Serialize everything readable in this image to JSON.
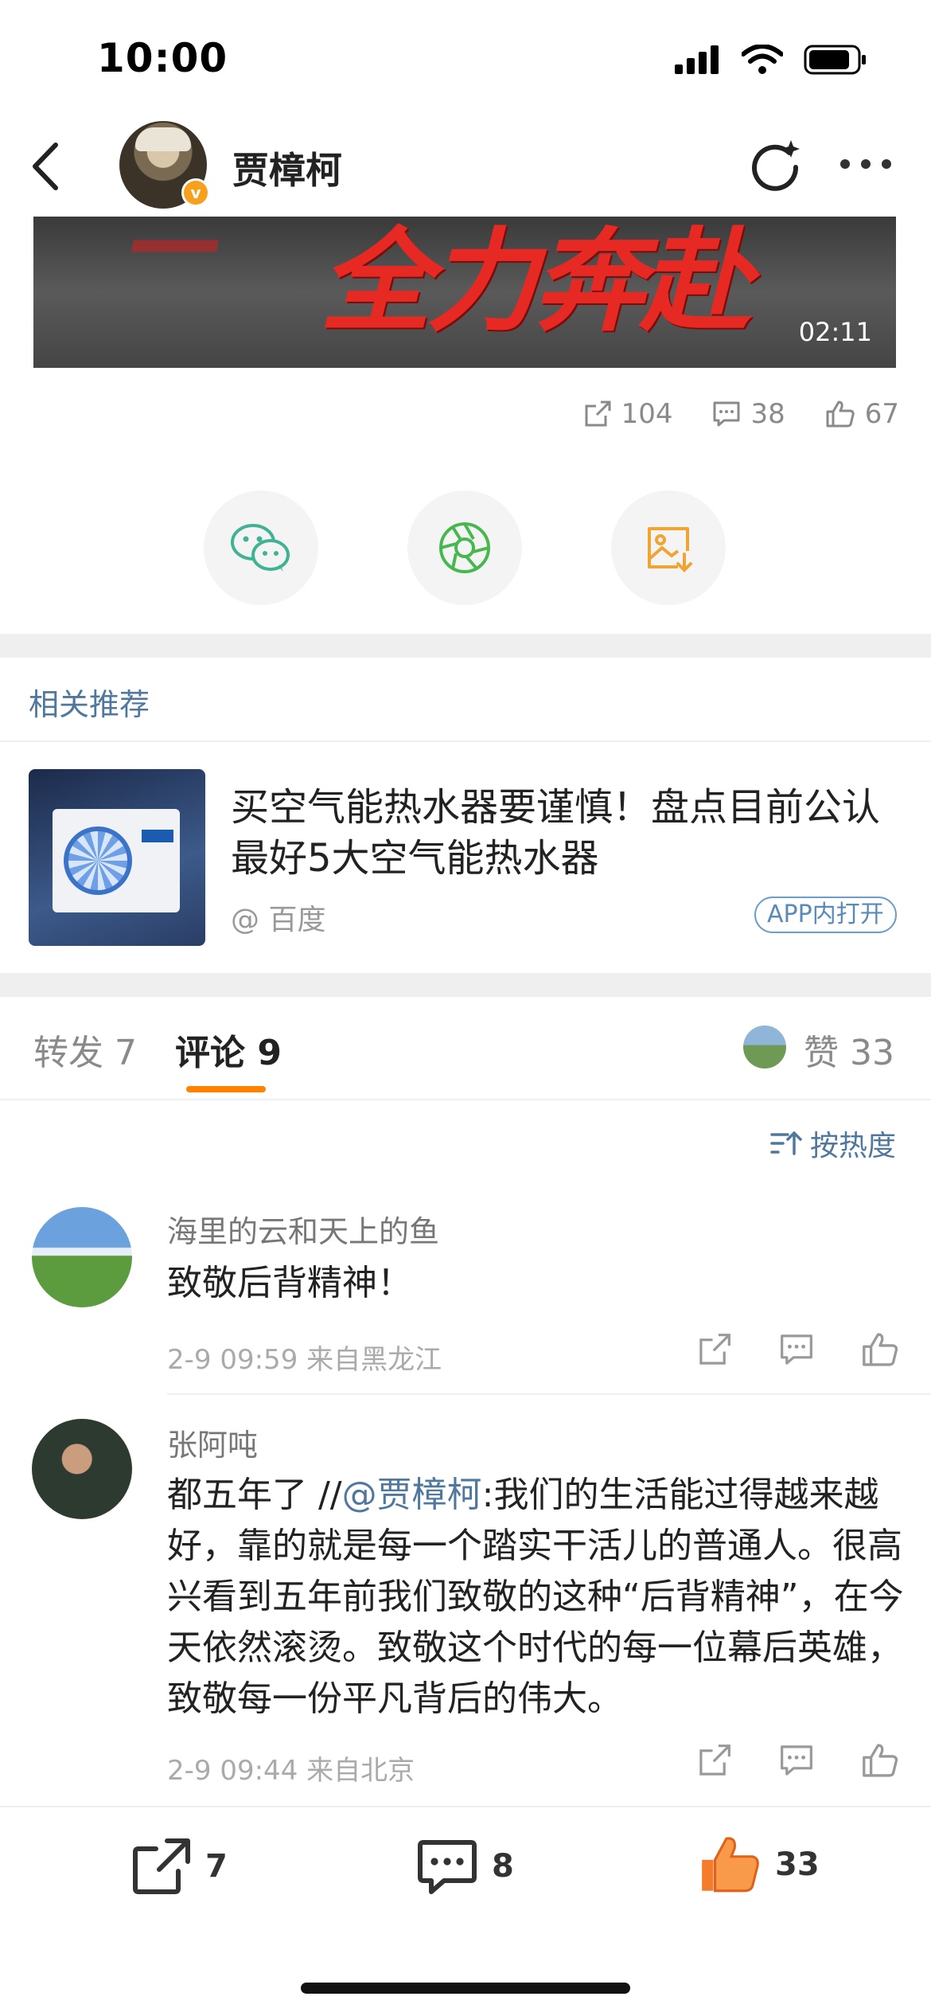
{
  "status_bar": {
    "time": "10:00"
  },
  "nav": {
    "name": "贾樟柯",
    "verified_mark": "v"
  },
  "video": {
    "overlay_text": "全力奔赴",
    "duration": "02:11"
  },
  "post_stats": {
    "reposts": "104",
    "comments": "38",
    "likes": "67"
  },
  "share_targets": [
    {
      "icon": "wechat-icon"
    },
    {
      "icon": "moments-icon"
    },
    {
      "icon": "save-image-icon"
    }
  ],
  "related": {
    "section_title": "相关推荐",
    "title": "买空气能热水器要谨慎！盘点目前公认最好5大空气能热水器",
    "source": "@ 百度",
    "open_badge": "APP内打开"
  },
  "tabs": {
    "forward_label": "转发 7",
    "comment_label": "评论 9",
    "like_label": "赞 33"
  },
  "sort_label": "按热度",
  "comments": [
    {
      "name": "海里的云和天上的鱼",
      "text": "致敬后背精神！",
      "meta": "2-9 09:59  来自黑龙江"
    },
    {
      "name": "张阿吨",
      "prefix": "都五年了 //",
      "mention": "@贾樟柯",
      "text": ":我们的生活能过得越来越好，靠的就是每一个踏实干活儿的普通人。很高兴看到五年前我们致敬的这种“后背精神”，在今天依然滚烫。致敬这个时代的每一位幕后英雄，致敬每一份平凡背后的伟大。",
      "meta": "2-9 09:44  来自北京"
    }
  ],
  "bottom_bar": {
    "reposts": "7",
    "comments": "8",
    "likes": "33"
  },
  "colors": {
    "accent": "#ff8200",
    "link": "#50789e",
    "like_orange": "#f57c2c"
  }
}
